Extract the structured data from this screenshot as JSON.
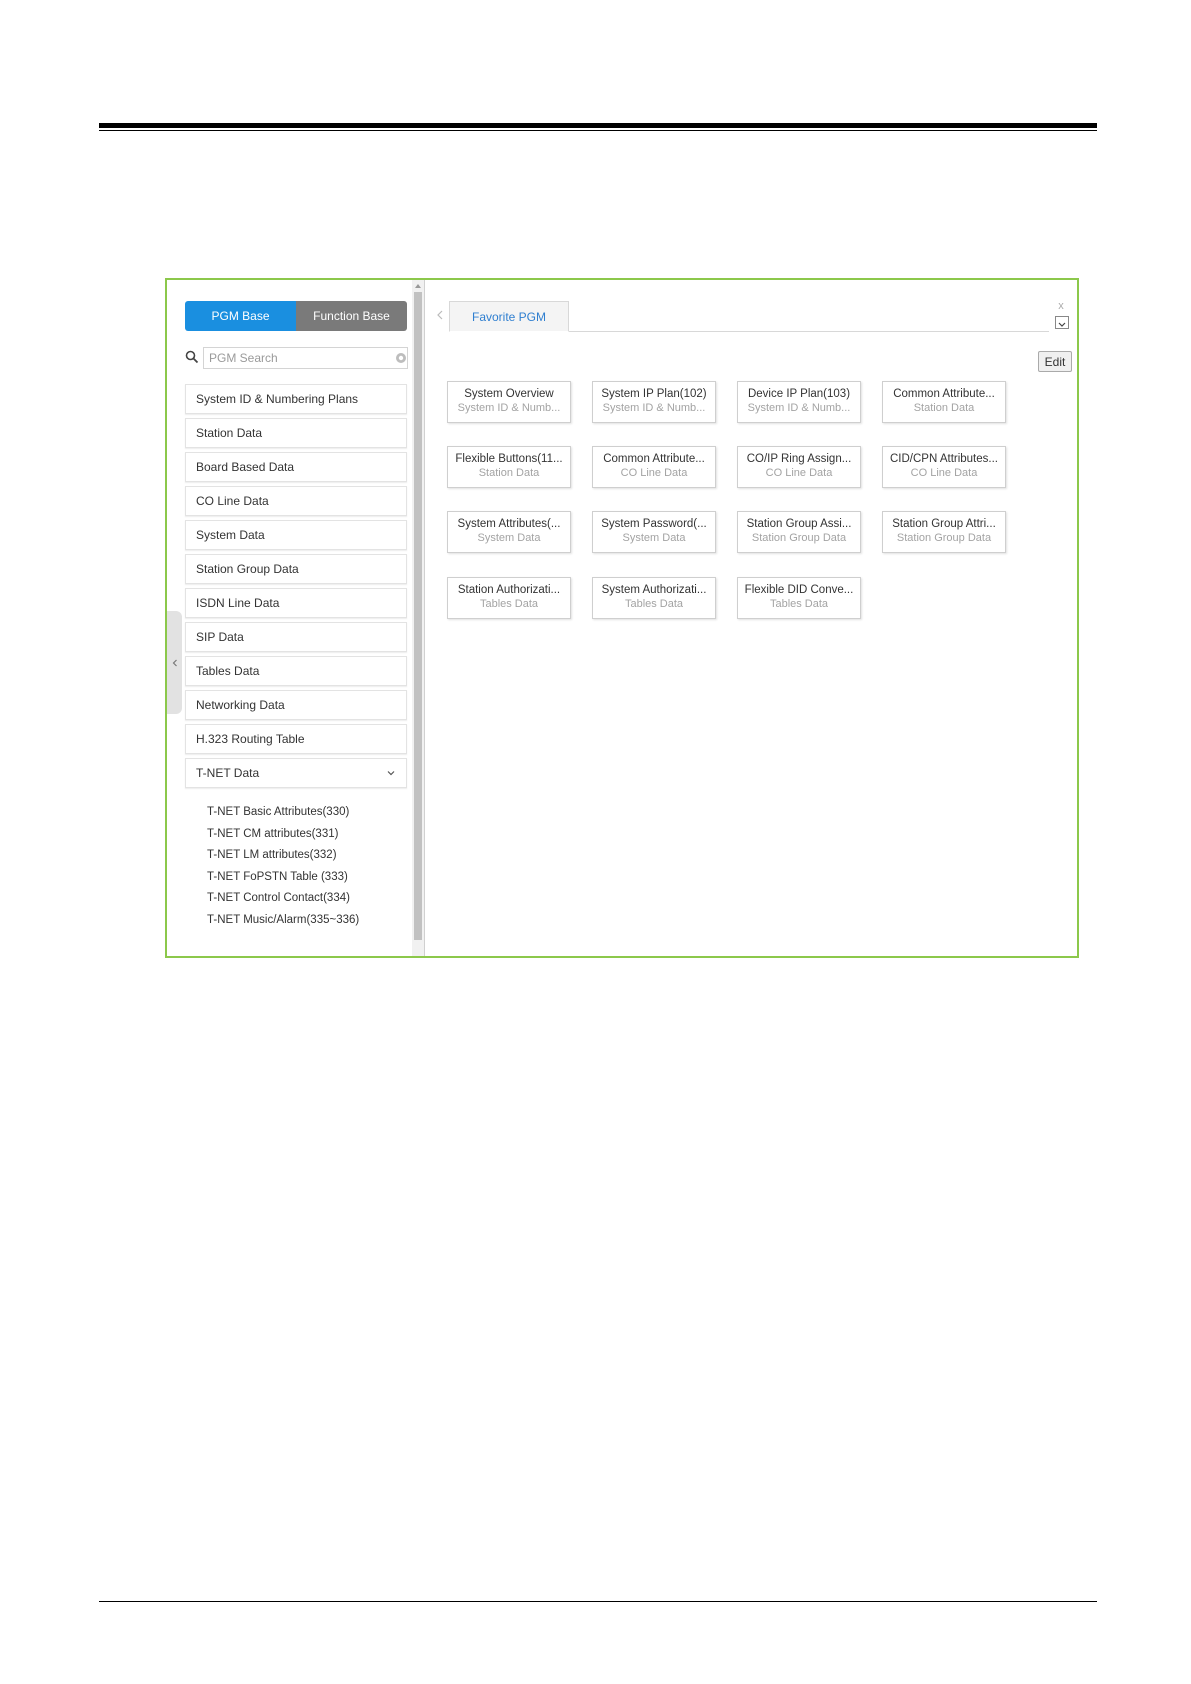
{
  "mode_tabs": {
    "pgm_base": "PGM Base",
    "function_base": "Function Base"
  },
  "search": {
    "placeholder": "PGM Search"
  },
  "menu": {
    "items": [
      "System ID & Numbering Plans",
      "Station Data",
      "Board Based Data",
      "CO Line Data",
      "System Data",
      "Station Group Data",
      "ISDN Line Data",
      "SIP Data",
      "Tables Data",
      "Networking Data",
      "H.323 Routing Table",
      "T-NET Data"
    ],
    "expanded_sub_items": [
      "T-NET Basic Attributes(330)",
      "T-NET CM attributes(331)",
      "T-NET LM attributes(332)",
      "T-NET FoPSTN Table (333)",
      "T-NET Control Contact(334)",
      "T-NET Music/Alarm(335~336)"
    ]
  },
  "tabs": {
    "favorite": "Favorite PGM",
    "close": "x"
  },
  "edit_label": "Edit",
  "cards": [
    {
      "title": "System Overview",
      "subtitle": "System ID & Numb..."
    },
    {
      "title": "System IP Plan(102)",
      "subtitle": "System ID & Numb..."
    },
    {
      "title": "Device IP Plan(103)",
      "subtitle": "System ID & Numb..."
    },
    {
      "title": "Common Attribute...",
      "subtitle": "Station Data"
    },
    {
      "title": "Flexible Buttons(11...",
      "subtitle": "Station Data"
    },
    {
      "title": "Common Attribute...",
      "subtitle": "CO Line Data"
    },
    {
      "title": "CO/IP Ring Assign...",
      "subtitle": "CO Line Data"
    },
    {
      "title": "CID/CPN Attributes...",
      "subtitle": "CO Line Data"
    },
    {
      "title": "System Attributes(...",
      "subtitle": "System Data"
    },
    {
      "title": "System Password(...",
      "subtitle": "System Data"
    },
    {
      "title": "Station Group Assi...",
      "subtitle": "Station Group Data"
    },
    {
      "title": "Station Group Attri...",
      "subtitle": "Station Group Data"
    },
    {
      "title": "Station Authorizati...",
      "subtitle": "Tables Data"
    },
    {
      "title": "System Authorizati...",
      "subtitle": "Tables Data"
    },
    {
      "title": "Flexible DID Conve...",
      "subtitle": "Tables Data"
    }
  ],
  "colors": {
    "accent": "#1a8fe0",
    "frame": "#8cc84b",
    "inactive_tab": "#7a7a7a",
    "tab_text": "#2f7fd0"
  },
  "icons": [
    "search-icon",
    "clear-icon",
    "chevron-down-icon",
    "chevron-left-icon",
    "dropdown-icon",
    "close-icon"
  ]
}
